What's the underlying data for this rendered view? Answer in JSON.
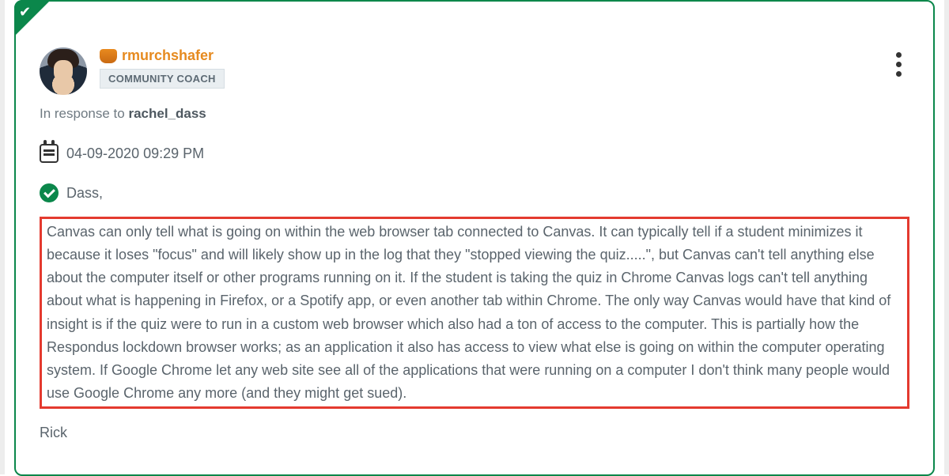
{
  "author": {
    "name": "rmurchshafer",
    "role": "COMMUNITY COACH"
  },
  "reply_to": {
    "prefix": "In response to ",
    "user": "rachel_dass"
  },
  "timestamp": "04-09-2020 09:29 PM",
  "greeting": "Dass,",
  "body": "Canvas can only tell what is going on within the web browser tab connected to Canvas.  It can typically tell if a student minimizes it because it loses \"focus\" and will likely show up in the log that they \"stopped viewing the quiz.....\", but Canvas can't tell anything else about the computer itself or other programs running on it.  If the student is taking the quiz in Chrome Canvas logs can't tell anything about what is happening in Firefox, or a Spotify app, or even another tab within Chrome.  The only way Canvas would have that kind of insight is if the quiz were to run in a custom web browser which also had a ton of access to the computer.  This is partially how the Respondus lockdown browser works; as an application it also has access to view what else is going on within the computer operating system.  If Google Chrome let any web site see all of the applications that were running on a computer I don't think many people would use Google Chrome any more (and they might get sued).",
  "signoff": "Rick",
  "highlight_color": "#e43a2f",
  "accent_color": "#0b874b"
}
